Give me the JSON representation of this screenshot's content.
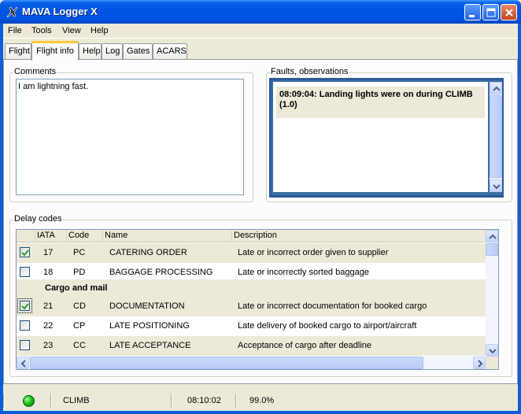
{
  "window": {
    "title": "MAVA Logger X"
  },
  "menu": [
    "File",
    "Tools",
    "View",
    "Help"
  ],
  "tabs": [
    {
      "label": "Flight",
      "active": false
    },
    {
      "label": "Flight info",
      "active": true
    },
    {
      "label": "Help",
      "active": false
    },
    {
      "label": "Log",
      "active": false
    },
    {
      "label": "Gates",
      "active": false
    },
    {
      "label": "ACARS",
      "active": false
    }
  ],
  "comments": {
    "label": "Comments",
    "value": "I am lightning fast."
  },
  "faults": {
    "label": "Faults, observations",
    "items": [
      "08:09:04: Landing lights were on during CLIMB (1.0)"
    ]
  },
  "delay_codes": {
    "label": "Delay codes",
    "columns": [
      "IATA",
      "Code",
      "Name",
      "Description"
    ],
    "rows": [
      {
        "checked": true,
        "iata": "17",
        "code": "PC",
        "name": "CATERING ORDER",
        "description": "Late or incorrect order given to supplier"
      },
      {
        "checked": false,
        "iata": "18",
        "code": "PD",
        "name": "BAGGAGE PROCESSING",
        "description": "Late or incorrectly sorted baggage"
      },
      {
        "group": "Cargo and mail"
      },
      {
        "checked": true,
        "focused": true,
        "iata": "21",
        "code": "CD",
        "name": "DOCUMENTATION",
        "description": "Late or incorrect documentation for booked cargo"
      },
      {
        "checked": false,
        "iata": "22",
        "code": "CP",
        "name": "LATE POSITIONING",
        "description": "Late delivery of booked cargo to airport/aircraft"
      },
      {
        "checked": false,
        "iata": "23",
        "code": "CC",
        "name": "LATE ACCEPTANCE",
        "description": "Acceptance of cargo after deadline"
      }
    ]
  },
  "status": {
    "indicator_color": "#19C019",
    "phase": "CLIMB",
    "time": "08:10:02",
    "percent": "99.0%"
  }
}
